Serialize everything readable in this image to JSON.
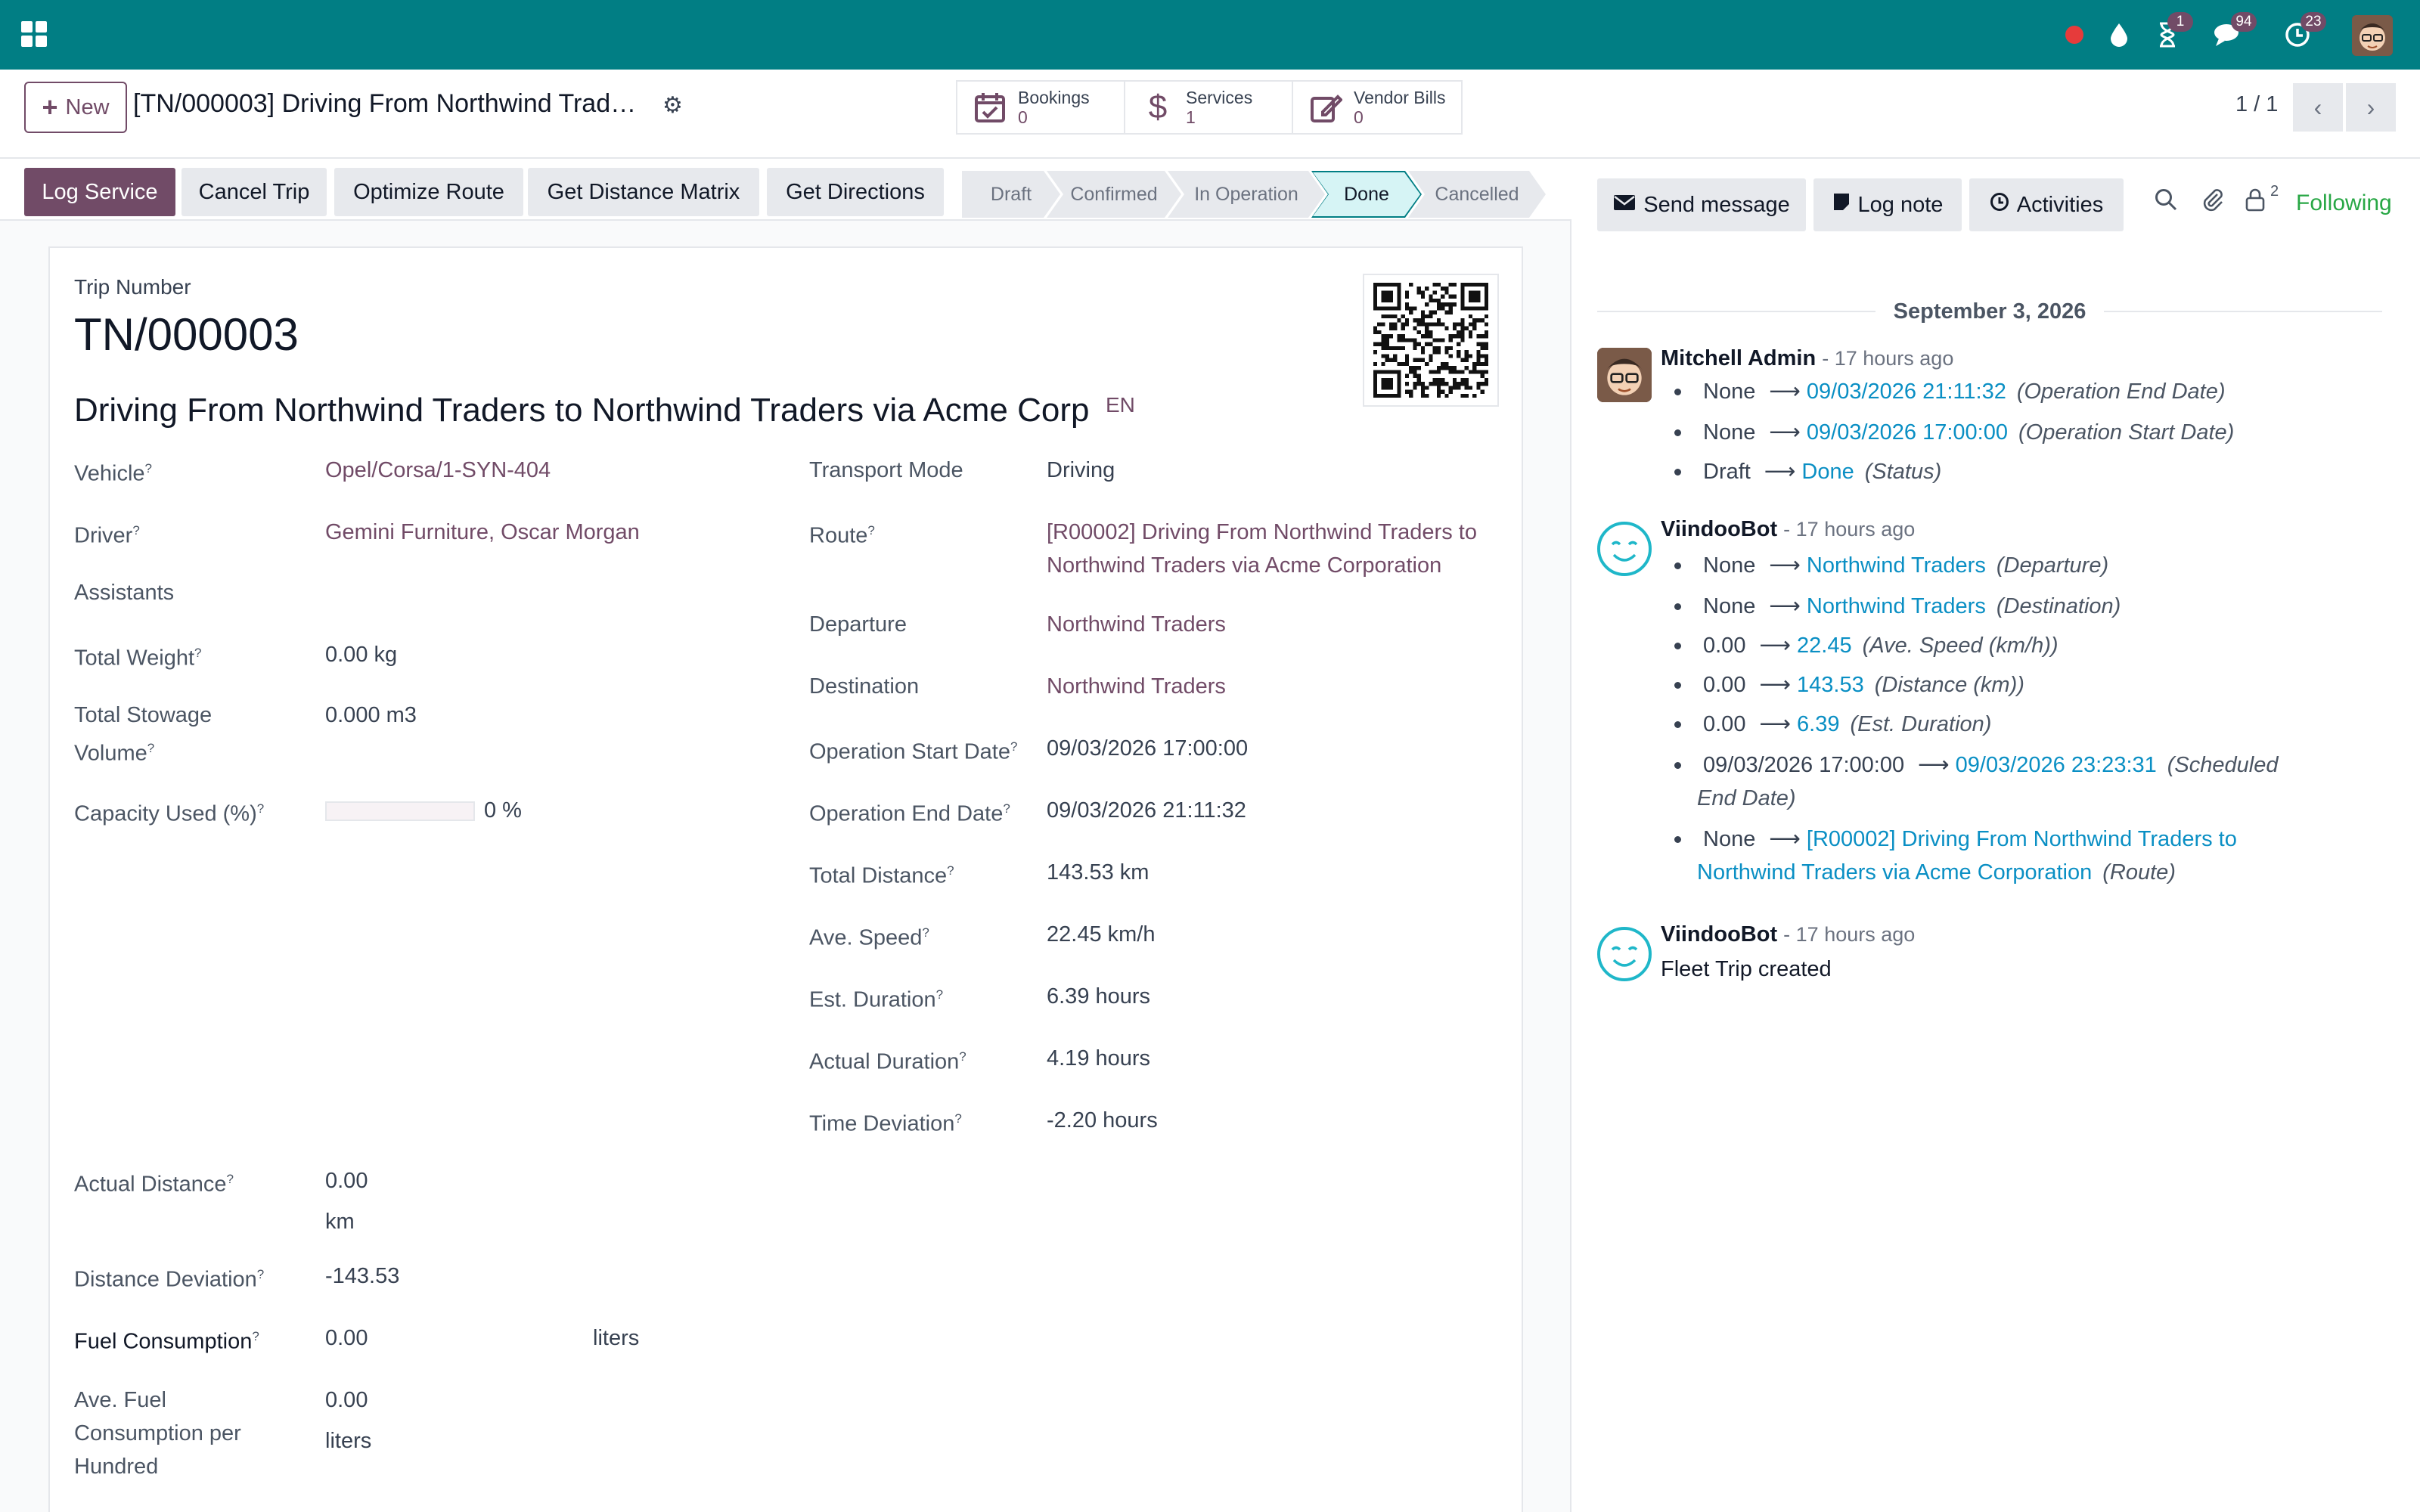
{
  "navbar": {
    "badges": {
      "activities": "1",
      "messages": "94",
      "updates": "23"
    }
  },
  "control_panel": {
    "new_label": "New",
    "title": "[TN/000003] Driving From Northwind Trad…",
    "smart_buttons": [
      {
        "label": "Bookings",
        "value": "0",
        "icon": "calendar-check-icon"
      },
      {
        "label": "Services",
        "value": "1",
        "icon": "dollar-icon"
      },
      {
        "label": "Vendor Bills",
        "value": "0",
        "icon": "edit-icon"
      }
    ],
    "pager": "1 / 1"
  },
  "statusbar": {
    "buttons": [
      "Log Service",
      "Cancel Trip",
      "Optimize Route",
      "Get Distance Matrix",
      "Get Directions"
    ],
    "stages": [
      "Draft",
      "Confirmed",
      "In Operation",
      "Done",
      "Cancelled"
    ],
    "active_stage": "Done"
  },
  "form": {
    "trip_number_label": "Trip Number",
    "trip_number": "TN/000003",
    "trip_name": "Driving From Northwind Traders to Northwind Traders via Acme Corp",
    "lang_tag": "EN",
    "left": {
      "vehicle_label": "Vehicle",
      "vehicle": "Opel/Corsa/1-SYN-404",
      "driver_label": "Driver",
      "driver": "Gemini Furniture, Oscar Morgan",
      "assistants_label": "Assistants",
      "total_weight_label": "Total Weight",
      "total_weight": "0.00 kg",
      "stowage_label_1": "Total Stowage",
      "stowage_label_2": "Volume",
      "stowage": "0.000 m3",
      "capacity_label": "Capacity Used (%)",
      "capacity": "0 %",
      "capacity_fraction": 0,
      "actual_distance_label": "Actual Distance",
      "actual_distance": "0.00",
      "actual_distance_unit": "km",
      "distance_deviation_label": "Distance Deviation",
      "distance_deviation": "-143.53",
      "fuel_label": "Fuel Consumption",
      "fuel": "0.00",
      "fuel_unit": "liters",
      "avg_fuel_label_1": "Ave. Fuel",
      "avg_fuel_label_2": "Consumption per",
      "avg_fuel_label_3": "Hundred",
      "avg_fuel": "0.00",
      "avg_fuel_unit": "liters"
    },
    "right": {
      "transport_mode_label": "Transport Mode",
      "transport_mode": "Driving",
      "route_label": "Route",
      "route_1": "[R00002] Driving From Northwind Traders to",
      "route_2": "Northwind Traders via Acme Corporation",
      "departure_label": "Departure",
      "departure": "Northwind Traders",
      "destination_label": "Destination",
      "destination": "Northwind Traders",
      "op_start_label": "Operation Start Date",
      "op_start": "09/03/2026 17:00:00",
      "op_end_label": "Operation End Date",
      "op_end": "09/03/2026 21:11:32",
      "total_distance_label": "Total Distance",
      "total_distance": "143.53 km",
      "avg_speed_label": "Ave. Speed",
      "avg_speed": "22.45 km/h",
      "est_duration_label": "Est. Duration",
      "est_duration": "6.39 hours",
      "actual_duration_label": "Actual Duration",
      "actual_duration": "4.19 hours",
      "time_deviation_label": "Time Deviation",
      "time_deviation": "-2.20 hours"
    }
  },
  "chatter": {
    "send_message": "Send message",
    "log_note": "Log note",
    "activities": "Activities",
    "followers_count": "2",
    "following": "Following",
    "date": "September 3, 2026",
    "messages": [
      {
        "author": "Mitchell Admin",
        "ago": "- 17 hours ago",
        "tracking": [
          {
            "old": "None",
            "new": "09/03/2026 21:11:32",
            "field": "(Operation End Date)"
          },
          {
            "old": "None",
            "new": "09/03/2026 17:00:00",
            "field": "(Operation Start Date)"
          },
          {
            "old": "Draft",
            "new": "Done",
            "field": "(Status)"
          }
        ]
      },
      {
        "author": "ViindooBot",
        "ago": "- 17 hours ago",
        "tracking": [
          {
            "old": "None",
            "new": "Northwind Traders",
            "field": "(Departure)"
          },
          {
            "old": "None",
            "new": "Northwind Traders",
            "field": "(Destination)"
          },
          {
            "old": "0.00",
            "new": "22.45",
            "field": "(Ave. Speed (km/h))"
          },
          {
            "old": "0.00",
            "new": "143.53",
            "field": "(Distance (km))"
          },
          {
            "old": "0.00",
            "new": "6.39",
            "field": "(Est. Duration)"
          },
          {
            "old": "09/03/2026 17:00:00",
            "new": "09/03/2026 23:23:31",
            "field": "(Scheduled",
            "field_2": "End Date)"
          },
          {
            "old": "None",
            "new": "[R00002] Driving From Northwind Traders to",
            "new_2": "Northwind Traders via Acme Corporation",
            "field": "(Route)"
          }
        ]
      },
      {
        "author": "ViindooBot",
        "ago": "- 17 hours ago",
        "body": "Fleet Trip created"
      }
    ]
  }
}
